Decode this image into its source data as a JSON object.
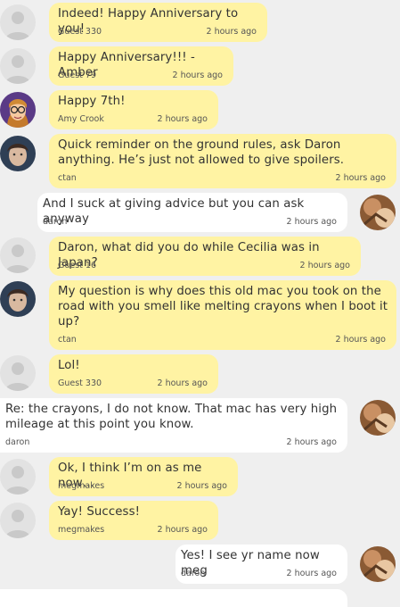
{
  "messages": [
    {
      "text": "Indeed! Happy Anniversary to you!",
      "author": "Guest 330",
      "time": "2 hours ago",
      "avatar": "guest-silhouette-icon",
      "side": "in"
    },
    {
      "text": "Happy Anniversary!!! -Amber",
      "author": "Guest 79",
      "time": "2 hours ago",
      "avatar": "guest-silhouette-icon",
      "side": "in"
    },
    {
      "text": "Happy 7th!",
      "author": "Amy Crook",
      "time": "2 hours ago",
      "avatar": "amy-cartoon-avatar",
      "side": "in"
    },
    {
      "text": "Quick reminder on the ground rules, ask Daron anything. He’s just not allowed to give spoilers.",
      "author": "ctan",
      "time": "2 hours ago",
      "avatar": "ctan-photo-avatar",
      "side": "in"
    },
    {
      "text": "And I suck at giving advice but you can ask anyway",
      "author": "daron",
      "time": "2 hours ago",
      "avatar": "daron-photo-avatar",
      "side": "out"
    },
    {
      "text": "Daron, what did you do while Cecilia was in Japan?",
      "author": "Guest 16",
      "time": "2 hours ago",
      "avatar": "guest-silhouette-icon",
      "side": "in"
    },
    {
      "text": "My question is why does this old mac you took on the road with you smell like melting crayons when I boot it up?",
      "author": "ctan",
      "time": "2 hours ago",
      "avatar": "ctan-photo-avatar",
      "side": "in"
    },
    {
      "text": "Lol!",
      "author": "Guest 330",
      "time": "2 hours ago",
      "avatar": "guest-silhouette-icon",
      "side": "in"
    },
    {
      "text": "Re: the crayons, I do not know. That mac has very high mileage at this point you know.",
      "author": "daron",
      "time": "2 hours ago",
      "avatar": "daron-photo-avatar",
      "side": "out"
    },
    {
      "text": "Ok, I think I’m on as me now…",
      "author": "megmakes",
      "time": "2 hours ago",
      "avatar": "guest-silhouette-icon",
      "side": "in"
    },
    {
      "text": "Yay! Success!",
      "author": "megmakes",
      "time": "2 hours ago",
      "avatar": "guest-silhouette-icon",
      "side": "in"
    },
    {
      "text": "Yes! I see yr name now meg",
      "author": "daron",
      "time": "2 hours ago",
      "avatar": "daron-photo-avatar",
      "side": "out"
    }
  ],
  "colors": {
    "incoming_bubble": "#fff3a3",
    "outgoing_bubble": "#ffffff",
    "background": "#efefef"
  }
}
